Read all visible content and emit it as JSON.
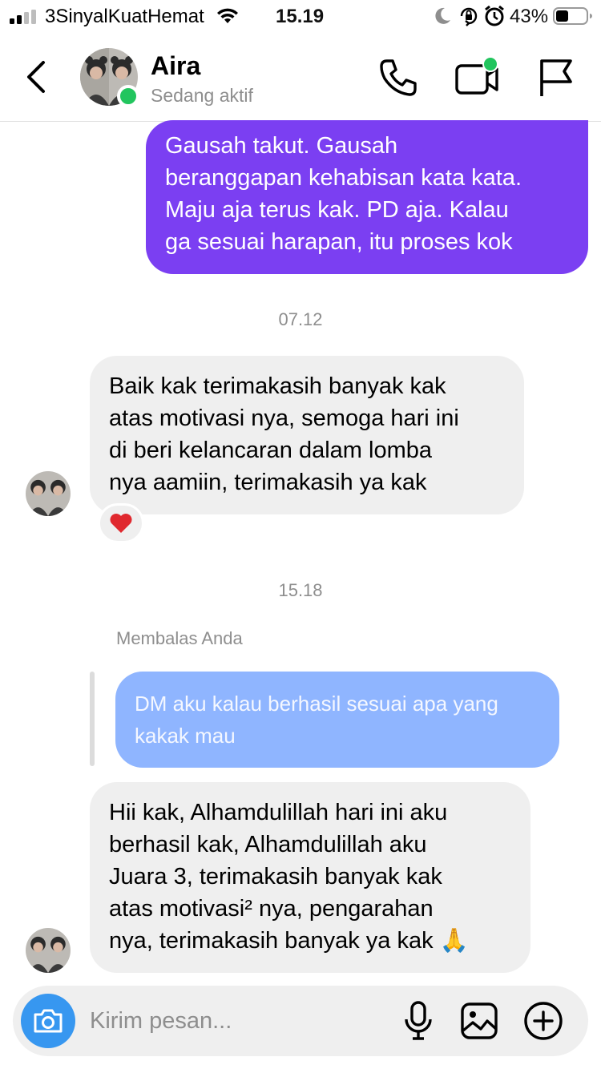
{
  "status_bar": {
    "carrier": "3SinyalKuatHemat",
    "time": "15.19",
    "battery_percent": "43%",
    "battery_level": 0.43,
    "icons": [
      "signal-icon",
      "wifi-icon",
      "moon-icon",
      "orientation-lock-icon",
      "alarm-icon",
      "battery-icon"
    ]
  },
  "header": {
    "contact_name": "Aira",
    "contact_status": "Sedang aktif",
    "online_color": "#22c55e",
    "icons": [
      "back-icon",
      "phone-icon",
      "video-call-icon",
      "flag-icon"
    ]
  },
  "messages": [
    {
      "direction": "sent",
      "lines": [
        "Gausah takut. Gausah",
        "beranggapan kehabisan kata kata.",
        "Maju aja terus kak. PD aja. Kalau",
        "ga sesuai harapan, itu proses kok"
      ]
    },
    {
      "timestamp": "07.12"
    },
    {
      "direction": "received",
      "lines": [
        "Baik kak terimakasih banyak kak",
        "atas motivasi nya, semoga hari ini",
        "di beri kelancaran dalam lomba",
        "nya aamiin, terimakasih ya kak"
      ],
      "reaction": "❤️"
    },
    {
      "timestamp": "15.18"
    },
    {
      "direction": "received",
      "reply_label": "Membalas Anda",
      "reply_quote_lines": [
        "DM aku kalau berhasil sesuai apa yang",
        "kakak mau"
      ],
      "lines": [
        "Hii kak, Alhamdulillah hari ini aku",
        "berhasil kak, Alhamdulillah aku",
        "Juara 3, terimakasih banyak kak",
        "atas motivasi² nya, pengarahan",
        "nya, terimakasih banyak ya kak 🙏"
      ]
    }
  ],
  "composer": {
    "placeholder": "Kirim pesan...",
    "value": "",
    "icons": [
      "camera-icon",
      "microphone-icon",
      "gallery-icon",
      "plus-icon"
    ]
  },
  "colors": {
    "sent_bubble": "#7b3ff2",
    "received_bubble": "#efefef",
    "reply_bubble": "#8fb5ff",
    "camera_button": "#3797f0"
  }
}
